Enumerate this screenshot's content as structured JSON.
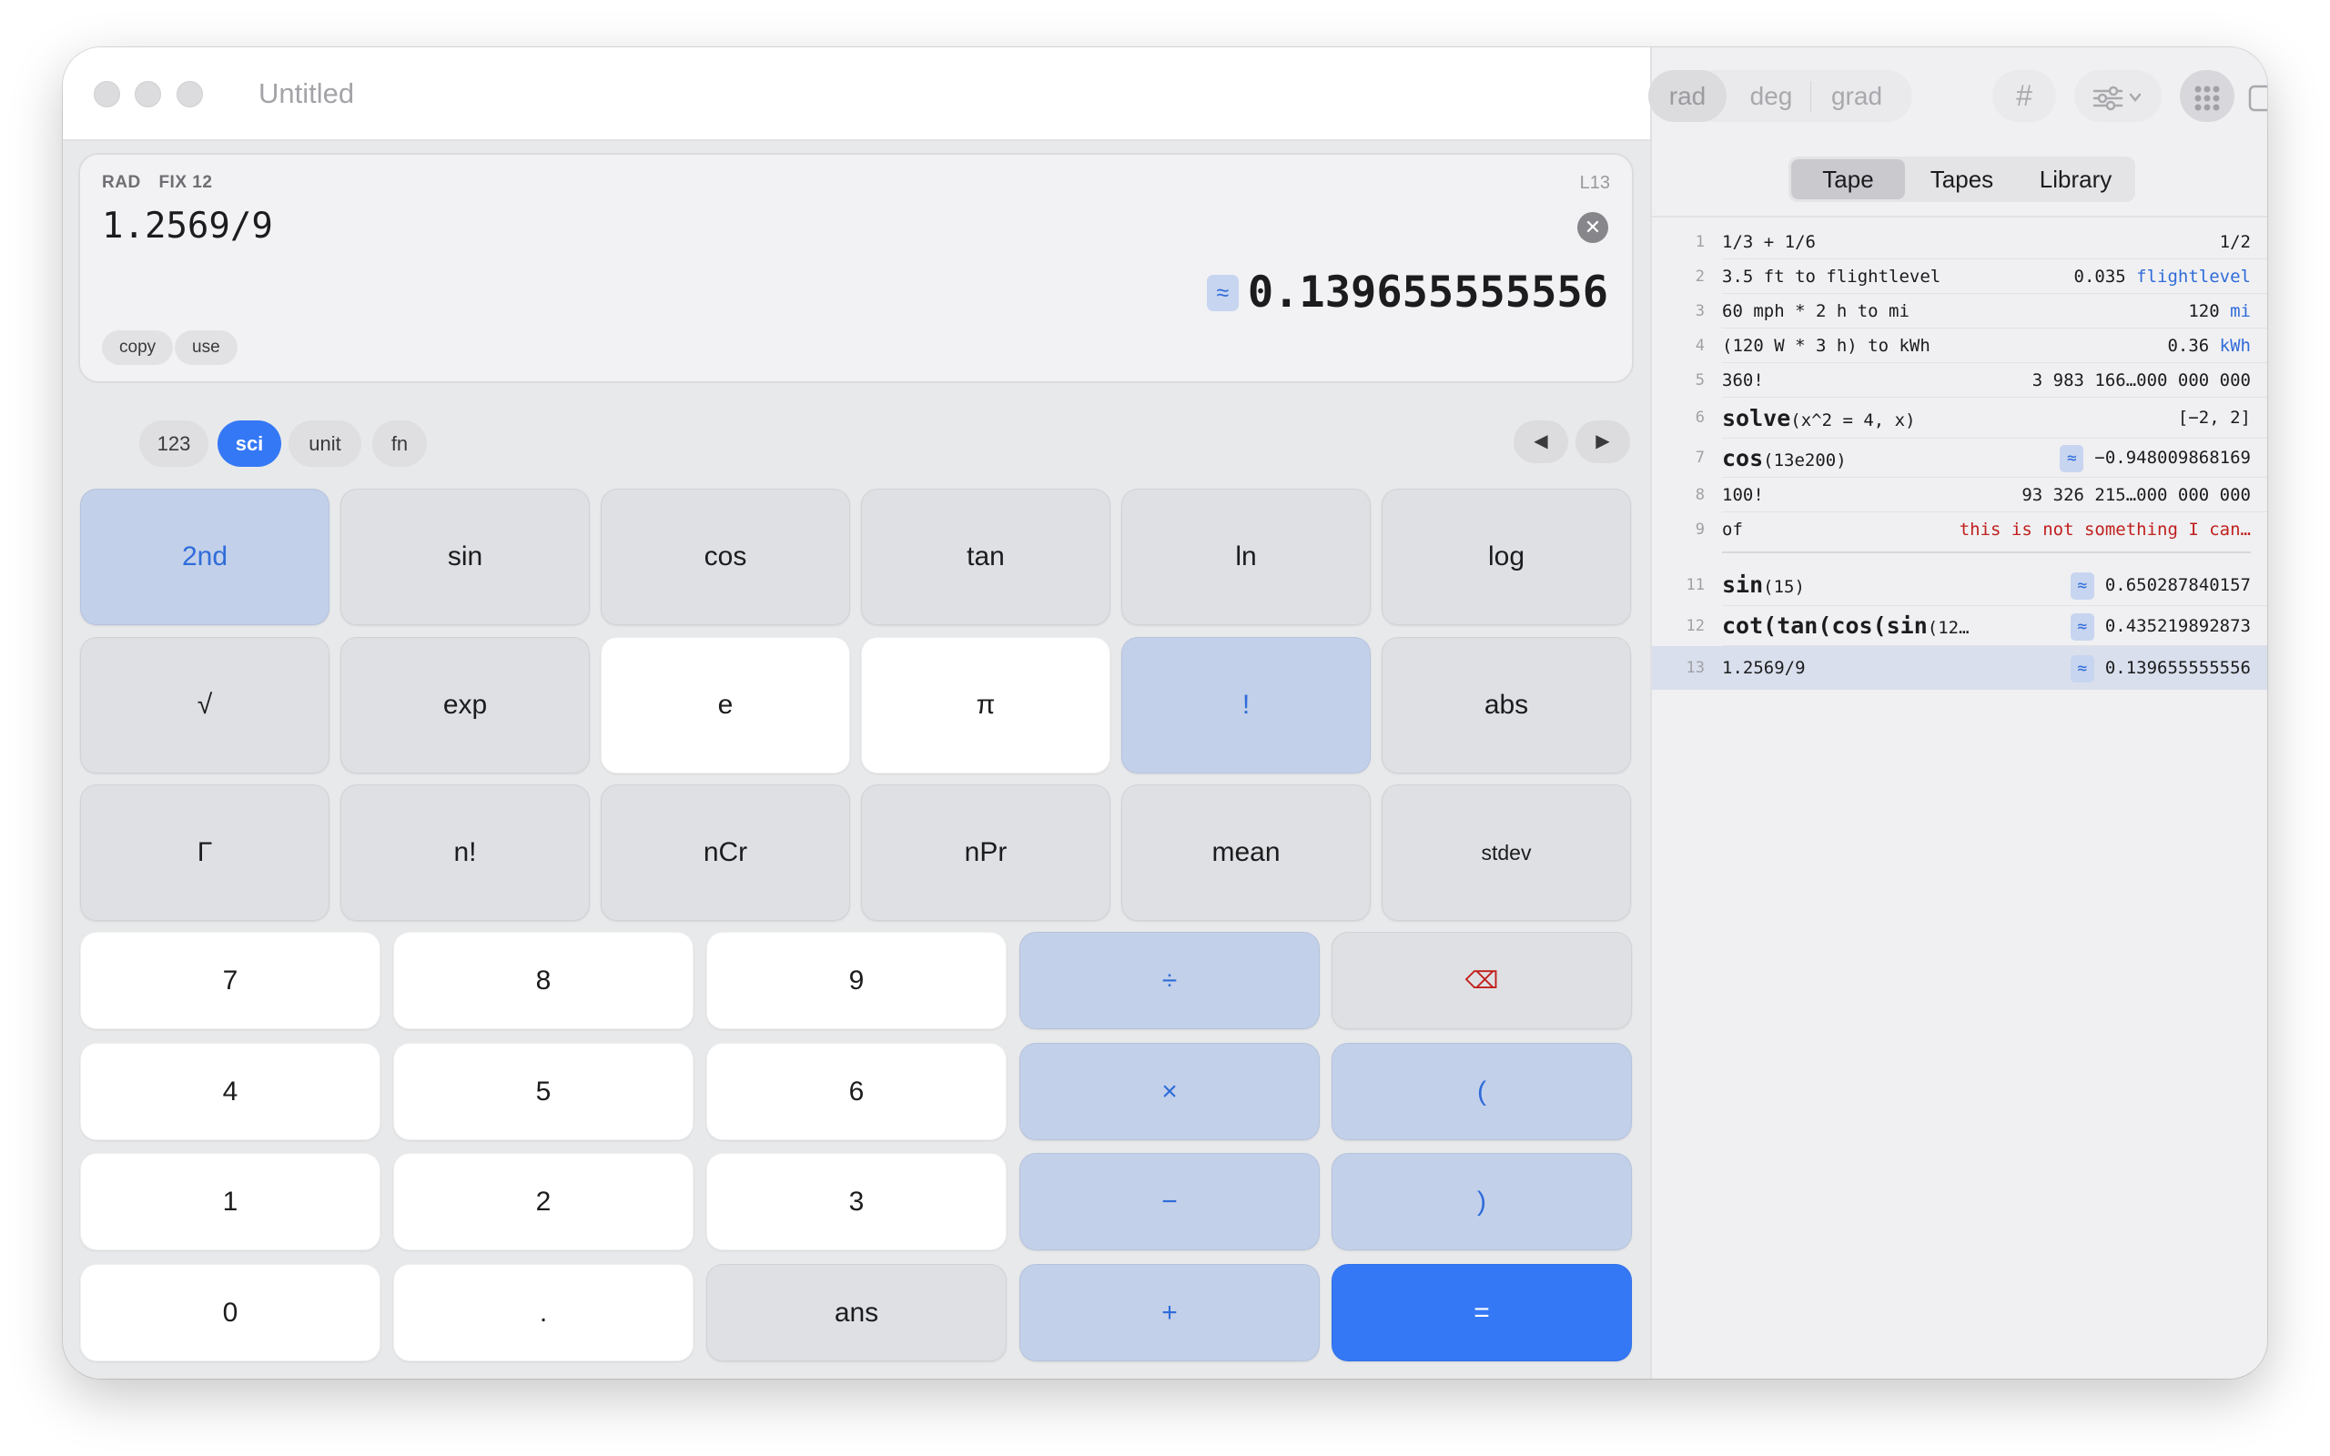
{
  "window": {
    "title": "Untitled"
  },
  "display": {
    "modes": [
      "RAD",
      "FIX 12"
    ],
    "line": "L13",
    "expression": "1.2569/9",
    "approx_symbol": "≈",
    "result": "0.139655555556",
    "actions": [
      "copy",
      "use"
    ]
  },
  "mode_tabs": [
    {
      "label": "123",
      "active": false
    },
    {
      "label": "sci",
      "active": true
    },
    {
      "label": "unit",
      "active": false
    },
    {
      "label": "fn",
      "active": false
    }
  ],
  "nav": {
    "prev": "◀",
    "next": "▶"
  },
  "sci_keys": [
    [
      "2nd",
      "sin",
      "cos",
      "tan",
      "ln",
      "log"
    ],
    [
      "√",
      "exp",
      "e",
      "π",
      "!",
      "abs"
    ],
    [
      "Γ",
      "n!",
      "nCr",
      "nPr",
      "mean",
      "stdev"
    ]
  ],
  "num_keys": [
    [
      "7",
      "8",
      "9",
      "÷",
      "⌫"
    ],
    [
      "4",
      "5",
      "6",
      "×",
      "("
    ],
    [
      "1",
      "2",
      "3",
      "−",
      ")"
    ],
    [
      "0",
      ".",
      "ans",
      "+",
      "="
    ]
  ],
  "angle_modes": [
    "rad",
    "deg",
    "grad"
  ],
  "toolbar_icons": [
    "hash-icon",
    "sliders-icon",
    "keypad-icon",
    "sidebar-icon"
  ],
  "sidebar_tabs": [
    {
      "label": "Tape",
      "active": true
    },
    {
      "label": "Tapes",
      "active": false
    },
    {
      "label": "Library",
      "active": false
    }
  ],
  "tape": [
    {
      "n": "1",
      "expr": "1/3 + 1/6",
      "result": "1/2"
    },
    {
      "n": "2",
      "expr": "3.5 ft to flightlevel",
      "result": "0.035",
      "unit": "flightlevel"
    },
    {
      "n": "3",
      "expr": "60 mph * 2 h to mi",
      "result": "120",
      "unit": "mi"
    },
    {
      "n": "4",
      "expr": "(120 W * 3 h) to kWh",
      "result": "0.36",
      "unit": "kWh"
    },
    {
      "n": "5",
      "expr": "360!",
      "result": "3 983 166…000 000 000"
    },
    {
      "n": "6",
      "fn": "solve",
      "expr": "(x^2 = 4, x)",
      "result": "[−2, 2]"
    },
    {
      "n": "7",
      "fn": "cos",
      "expr": "(13e200)",
      "result": "−0.948009868169",
      "approx": true
    },
    {
      "n": "8",
      "expr": "100!",
      "result": "93 326 215…000 000 000"
    },
    {
      "n": "9",
      "expr": "of",
      "result": "this is not something I can…",
      "error": true
    },
    {
      "n": "11",
      "fn": "sin",
      "expr": "(15)",
      "result": "0.650287840157",
      "approx": true
    },
    {
      "n": "12",
      "fn": "cot(tan(cos(sin",
      "expr": "(12…",
      "result": "0.435219892873",
      "approx": true
    },
    {
      "n": "13",
      "expr": "1.2569/9",
      "result": "0.139655555556",
      "approx": true,
      "selected": true
    }
  ],
  "colors": {
    "accent": "#3478f6",
    "operator_key": "#c2d0ea",
    "error": "#c0201d"
  }
}
